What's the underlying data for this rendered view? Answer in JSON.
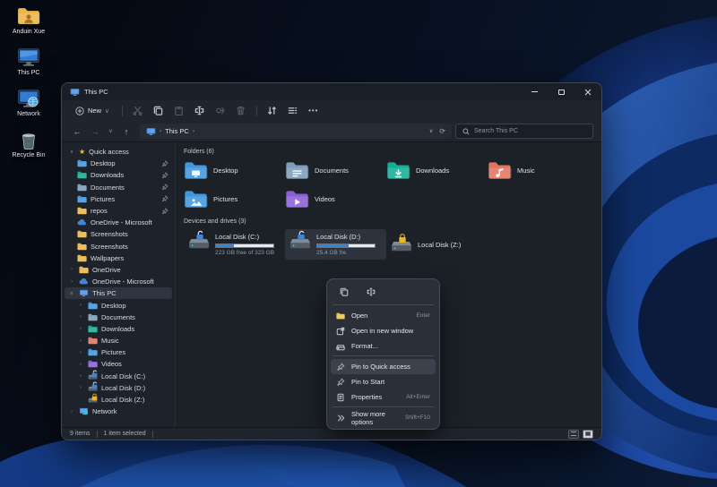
{
  "icons": {
    "chevron_down": "∨",
    "chevron_right": "›",
    "star": "★",
    "back": "←",
    "forward": "→",
    "up": "↑",
    "refresh": "⟳",
    "more_dots": "•••",
    "breadcrumb_sep": "›"
  },
  "desktop": {
    "icons": [
      {
        "label": "Anduin Xue",
        "icon": "user-folder-icon"
      },
      {
        "label": "This PC",
        "icon": "pc-icon"
      },
      {
        "label": "Network",
        "icon": "network-icon"
      },
      {
        "label": "Recycle Bin",
        "icon": "recycle-bin-icon"
      }
    ]
  },
  "window": {
    "title": "This PC",
    "toolbar": {
      "new_label": "New"
    },
    "addressbar": {
      "breadcrumb_root": "This PC",
      "search_placeholder": "Search This PC"
    },
    "sidebar": {
      "quick_access": {
        "label": "Quick access",
        "items": [
          {
            "label": "Desktop",
            "pinned": true
          },
          {
            "label": "Downloads",
            "pinned": true
          },
          {
            "label": "Documents",
            "pinned": true
          },
          {
            "label": "Pictures",
            "pinned": true
          },
          {
            "label": "repos",
            "pinned": true
          },
          {
            "label": "OneDrive - Microsoft",
            "pinned": false
          },
          {
            "label": "Screenshots",
            "pinned": false
          },
          {
            "label": "Screenshots",
            "pinned": false
          },
          {
            "label": "Wallpapers",
            "pinned": false
          }
        ]
      },
      "onedrive": {
        "label": "OneDrive"
      },
      "onedrive_ms": {
        "label": "OneDrive - Microsoft"
      },
      "this_pc": {
        "label": "This PC",
        "children": [
          {
            "label": "Desktop"
          },
          {
            "label": "Documents"
          },
          {
            "label": "Downloads"
          },
          {
            "label": "Music"
          },
          {
            "label": "Pictures"
          },
          {
            "label": "Videos"
          },
          {
            "label": "Local Disk (C:)"
          },
          {
            "label": "Local Disk (D:)"
          },
          {
            "label": "Local Disk (Z:)"
          }
        ]
      },
      "network": {
        "label": "Network"
      }
    },
    "content": {
      "folders_section": "Folders (6)",
      "folders": [
        {
          "name": "Desktop"
        },
        {
          "name": "Documents"
        },
        {
          "name": "Downloads"
        },
        {
          "name": "Music"
        },
        {
          "name": "Pictures"
        },
        {
          "name": "Videos"
        }
      ],
      "drives_section": "Devices and drives (3)",
      "drives": [
        {
          "name": "Local Disk (C:)",
          "capacity": "223 GB free of 323 GB",
          "used_pct": 31,
          "lock": "unlocked"
        },
        {
          "name": "Local Disk (D:)",
          "capacity": "25.4 GB fre",
          "used_pct": 55,
          "lock": "unlocked",
          "selected": true
        },
        {
          "name": "Local Disk (Z:)",
          "lock": "locked"
        }
      ]
    },
    "context_menu": {
      "items": [
        {
          "label": "Open",
          "shortcut": "Enter"
        },
        {
          "label": "Open in new window",
          "shortcut": ""
        },
        {
          "label": "Format...",
          "shortcut": ""
        },
        {
          "label": "Pin to Quick access",
          "shortcut": ""
        },
        {
          "label": "Pin to Start",
          "shortcut": ""
        },
        {
          "label": "Properties",
          "shortcut": "Alt+Enter"
        },
        {
          "label": "Show more options",
          "shortcut": "Shift+F10"
        }
      ]
    },
    "status_bar": {
      "items_count": "9 items",
      "selection": "1 item selected"
    }
  },
  "colors": {
    "accent": "#4cc2ff",
    "drive_bar_fill": "#2f86d8",
    "lock_unlocked": "#3f86d8",
    "lock_locked": "#ecba1f",
    "folder_yellow": "#e9b64a"
  }
}
